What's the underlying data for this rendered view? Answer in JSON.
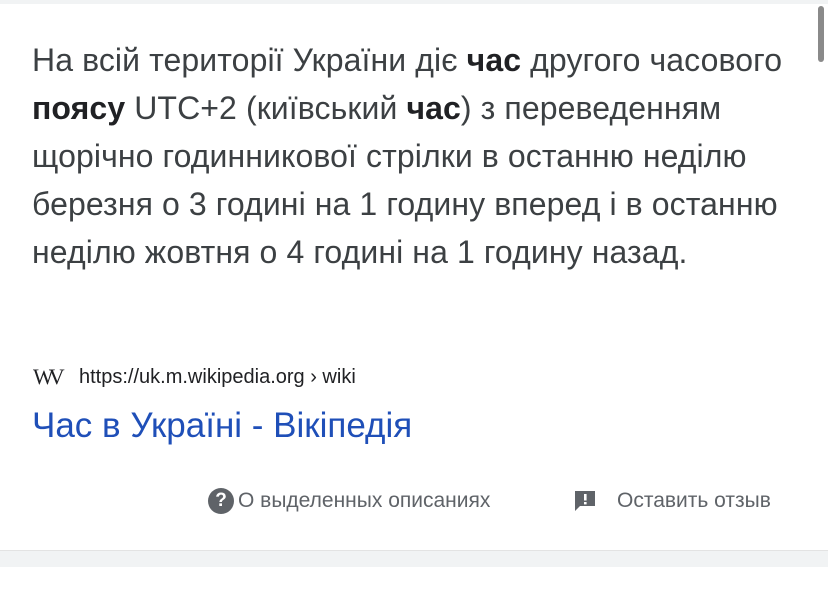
{
  "snippet": {
    "segments": [
      {
        "text": "На всій території України діє ",
        "bold": false
      },
      {
        "text": "час",
        "bold": true
      },
      {
        "text": " другого часового ",
        "bold": false
      },
      {
        "text": "поясу",
        "bold": true
      },
      {
        "text": " UTC+2 (київський ",
        "bold": false
      },
      {
        "text": "час",
        "bold": true
      },
      {
        "text": ") з переведенням щорічно годинникової стрілки в останню неділю березня о 3 годині на 1 годину вперед і в останню неділю жовтня о 4 годині на 1 годину назад.",
        "bold": false
      }
    ]
  },
  "source": {
    "logo_text": "W",
    "logo_icon": "wikipedia-w-icon",
    "url": "https://uk.m.wikipedia.org › wiki"
  },
  "result": {
    "title": "Час в Україні - Вікіпедія",
    "link_color": "#1f4fb8"
  },
  "footer": {
    "about_icon": "help-circle-icon",
    "about_icon_glyph": "?",
    "about_label": "О выделенных описаниях",
    "feedback_icon": "feedback-flag-icon",
    "feedback_label": "Оставить отзыв"
  }
}
